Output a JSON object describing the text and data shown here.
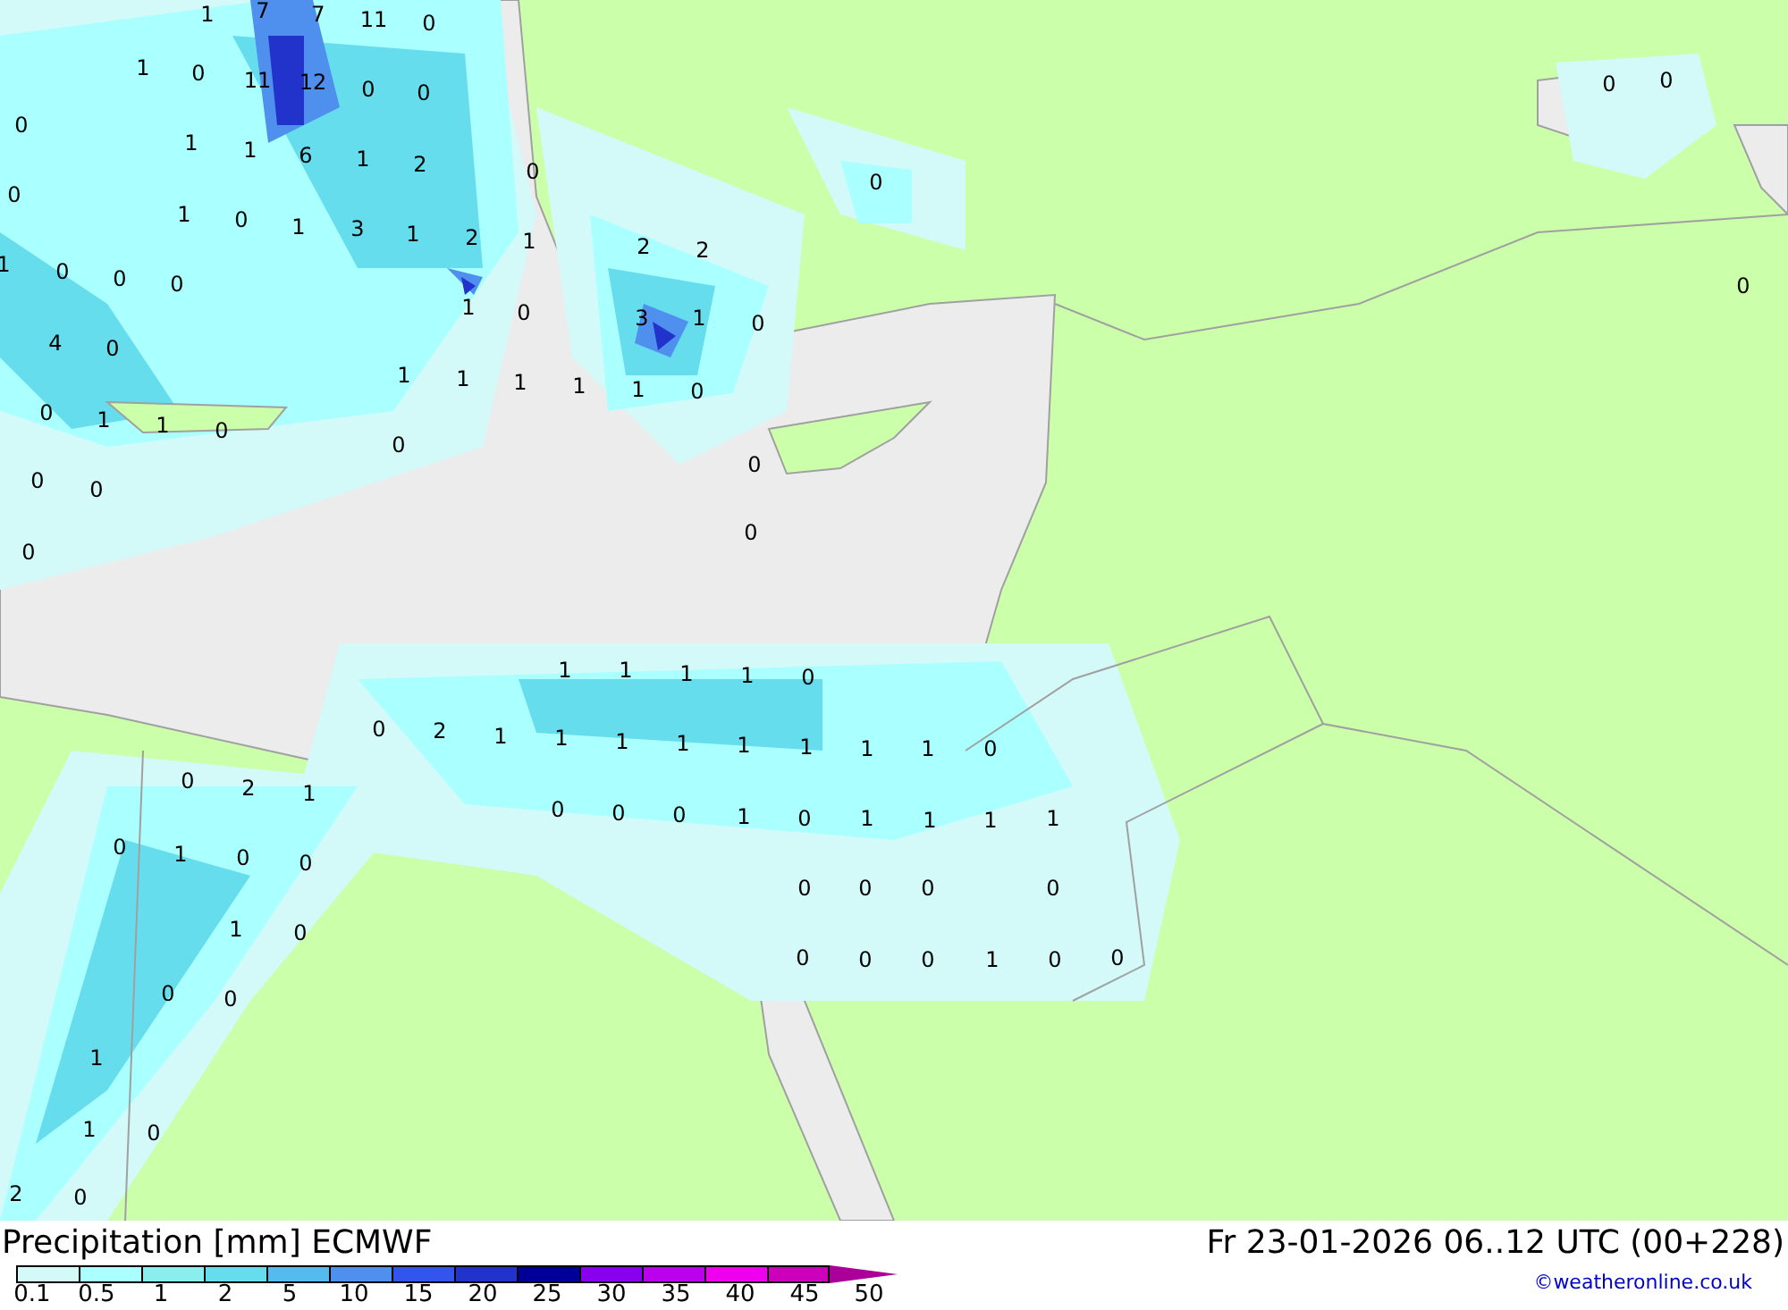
{
  "map": {
    "labels": [
      "1",
      "7",
      "7",
      "11",
      "0",
      "1",
      "0",
      "11",
      "12",
      "0",
      "0",
      "0",
      "1",
      "1",
      "6",
      "1",
      "2",
      "0",
      "0",
      "1",
      "0",
      "1",
      "3",
      "1",
      "2",
      "1",
      "1",
      "0",
      "0",
      "0",
      "1",
      "0",
      "4",
      "0",
      "1",
      "1",
      "1",
      "0",
      "1",
      "1",
      "0",
      "0",
      "0",
      "0",
      "0",
      "0",
      "2",
      "2",
      "3",
      "1",
      "0",
      "1",
      "1",
      "0",
      "0",
      "0",
      "0",
      "0",
      "0",
      "1",
      "1",
      "1",
      "1",
      "0",
      "0",
      "2",
      "1",
      "1",
      "1",
      "1",
      "1",
      "1",
      "1",
      "1",
      "0",
      "0",
      "0",
      "0",
      "1",
      "0",
      "1",
      "1",
      "1",
      "1",
      "0",
      "0",
      "0",
      "0",
      "0",
      "0",
      "0",
      "1",
      "0",
      "0",
      "0",
      "2",
      "1",
      "0",
      "1",
      "0",
      "0",
      "1",
      "0",
      "0",
      "0",
      "1",
      "1",
      "0",
      "2",
      "0"
    ]
  },
  "footer": {
    "title": "Precipitation [mm] ECMWF",
    "valid_time": "Fr 23-01-2026 06..12 UTC (00+228)",
    "credit": "©weatheronline.co.uk"
  },
  "legend": {
    "bins": [
      {
        "color": "#d3f9f9"
      },
      {
        "color": "#aaffff"
      },
      {
        "color": "#8aeeee"
      },
      {
        "color": "#66dded"
      },
      {
        "color": "#55bbee"
      },
      {
        "color": "#4f8fee"
      },
      {
        "color": "#3355ee"
      },
      {
        "color": "#2233cc"
      },
      {
        "color": "#000099"
      },
      {
        "color": "#8800ee"
      },
      {
        "color": "#bb00ee"
      },
      {
        "color": "#ee00ee"
      },
      {
        "color": "#cc00bb"
      },
      {
        "color": "#aa0099",
        "kind": "arrow"
      }
    ],
    "labels": [
      "0.1",
      "0.5",
      "1",
      "2",
      "5",
      "10",
      "15",
      "20",
      "25",
      "30",
      "35",
      "40",
      "45",
      "50"
    ]
  }
}
